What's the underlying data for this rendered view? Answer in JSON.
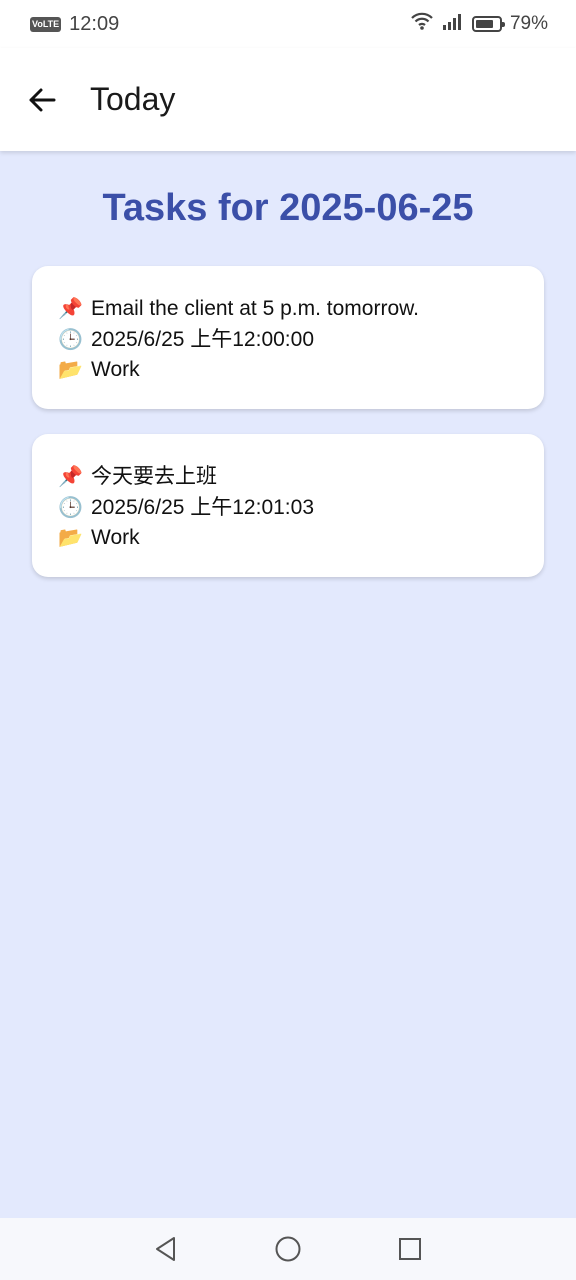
{
  "status_bar": {
    "network_badge": "VoLTE",
    "time": "12:09",
    "battery_level": 0.79,
    "battery_text": "79%",
    "icons": [
      "wifi-icon",
      "signal-icon",
      "battery-icon"
    ]
  },
  "app_bar": {
    "back_icon": "arrow-left-icon",
    "title": "Today"
  },
  "page": {
    "heading": "Tasks for 2025-06-25",
    "heading_color": "#3b4fa8",
    "background_color": "#e3e9fd"
  },
  "tasks": [
    {
      "pin_emoji": "📌",
      "title": "Email the client at 5 p.m. tomorrow.",
      "clock_emoji": "🕒",
      "datetime": "2025/6/25 上午12:00:00",
      "folder_emoji": "📂",
      "category": "Work"
    },
    {
      "pin_emoji": "📌",
      "title": "今天要去上班",
      "clock_emoji": "🕒",
      "datetime": "2025/6/25 上午12:01:03",
      "folder_emoji": "📂",
      "category": "Work"
    }
  ],
  "nav_bar": {
    "buttons": [
      "back-triangle-icon",
      "home-circle-icon",
      "recents-square-icon"
    ]
  }
}
